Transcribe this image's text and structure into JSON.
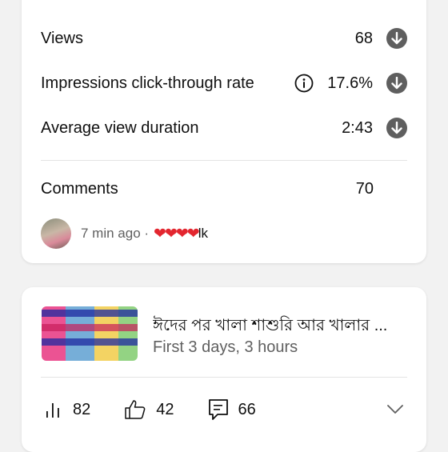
{
  "metrics": [
    {
      "label": "Views",
      "value": "68"
    },
    {
      "label": "Impressions click-through rate",
      "value": "17.6%"
    },
    {
      "label": "Average view duration",
      "value": "2:43"
    }
  ],
  "comments": {
    "label": "Comments",
    "count": "70",
    "latest": {
      "time": "7 min ago ·",
      "text": "lk"
    }
  },
  "video": {
    "title": "ঈদের পর খালা শাশুরি আর খালার ...",
    "subtitle": "First 3 days, 3 hours",
    "views": "82",
    "likes": "42",
    "comments": "66"
  },
  "icons": {
    "down_arrow": "arrow-down-circle-icon",
    "info": "info-icon",
    "bars": "bar-chart-icon",
    "like": "thumbs-up-icon",
    "comment": "comment-icon",
    "expand": "chevron-down-icon"
  }
}
